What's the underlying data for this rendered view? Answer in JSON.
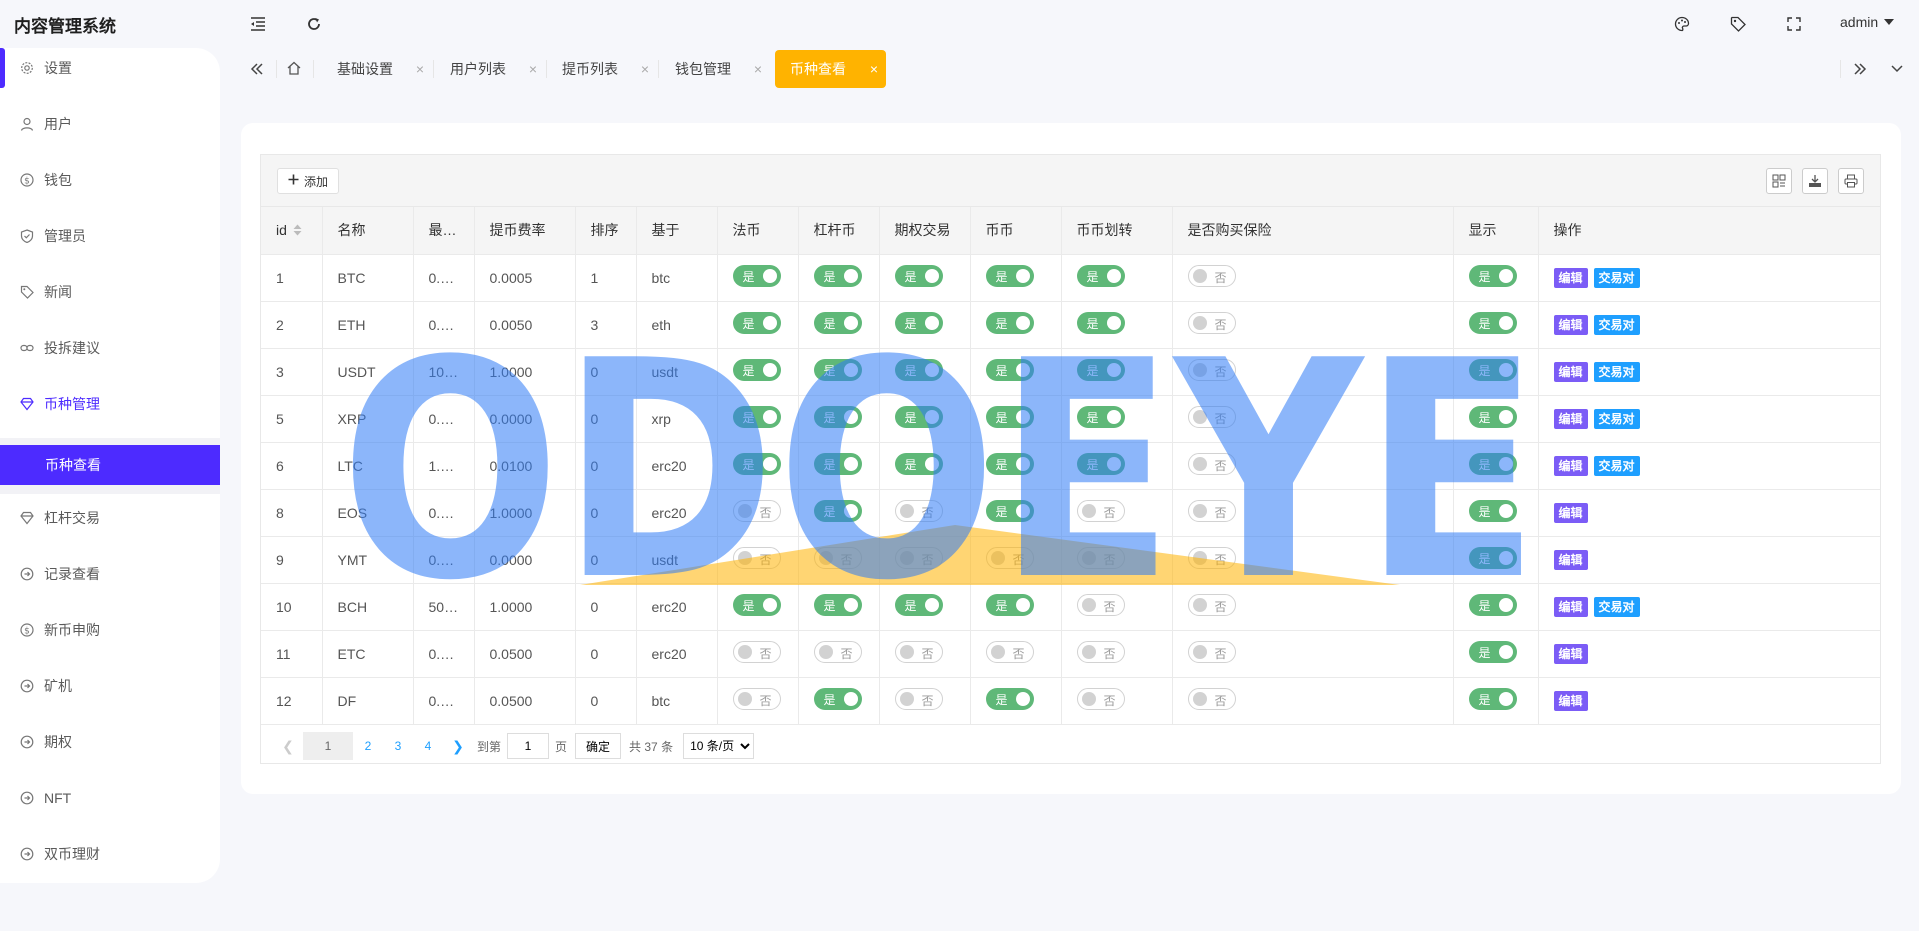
{
  "app": {
    "title": "内容管理系统",
    "user": "admin"
  },
  "sidebar": {
    "items": [
      {
        "label": "设置",
        "icon": "gear-icon"
      },
      {
        "label": "用户",
        "icon": "user-icon"
      },
      {
        "label": "钱包",
        "icon": "coin-icon"
      },
      {
        "label": "管理员",
        "icon": "shield-icon"
      },
      {
        "label": "新闻",
        "icon": "tag-icon"
      },
      {
        "label": "投拆建议",
        "icon": "link-icon"
      },
      {
        "label": "币种管理",
        "icon": "diamond-icon"
      },
      {
        "label": "杠杆交易",
        "icon": "diamond-icon"
      },
      {
        "label": "记录查看",
        "icon": "circle-icon"
      },
      {
        "label": "新币申购",
        "icon": "coin-icon"
      },
      {
        "label": "矿机",
        "icon": "circle-icon"
      },
      {
        "label": "期权",
        "icon": "circle-icon"
      },
      {
        "label": "NFT",
        "icon": "circle-icon"
      },
      {
        "label": "双币理财",
        "icon": "circle-icon"
      }
    ],
    "active_sub": "币种查看"
  },
  "tabs": [
    {
      "label": "基础设置"
    },
    {
      "label": "用户列表"
    },
    {
      "label": "提币列表"
    },
    {
      "label": "钱包管理"
    },
    {
      "label": "币种查看"
    }
  ],
  "toolbar": {
    "add_label": "添加"
  },
  "table": {
    "columns": [
      "id",
      "名称",
      "最…",
      "提币费率",
      "排序",
      "基于",
      "法币",
      "杠杆币",
      "期权交易",
      "币币",
      "币币划转",
      "是否购买保险",
      "显示",
      "操作"
    ],
    "switch_on": "是",
    "switch_off": "否",
    "edit_label": "编辑",
    "pair_label": "交易对",
    "rows": [
      {
        "id": "1",
        "name": "BTC",
        "min": "0.…",
        "fee": "0.0005",
        "sort": "1",
        "base": "btc",
        "fiat": true,
        "lev": true,
        "opt": true,
        "coin": true,
        "transfer": true,
        "ins": false,
        "show": true,
        "pair": true
      },
      {
        "id": "2",
        "name": "ETH",
        "min": "0.…",
        "fee": "0.0050",
        "sort": "3",
        "base": "eth",
        "fiat": true,
        "lev": true,
        "opt": true,
        "coin": true,
        "transfer": true,
        "ins": false,
        "show": true,
        "pair": true
      },
      {
        "id": "3",
        "name": "USDT",
        "min": "10…",
        "fee": "1.0000",
        "sort": "0",
        "base": "usdt",
        "fiat": true,
        "lev": true,
        "opt": true,
        "coin": true,
        "transfer": true,
        "ins": false,
        "show": true,
        "pair": true
      },
      {
        "id": "5",
        "name": "XRP",
        "min": "0.…",
        "fee": "0.0000",
        "sort": "0",
        "base": "xrp",
        "fiat": true,
        "lev": true,
        "opt": true,
        "coin": true,
        "transfer": true,
        "ins": false,
        "show": true,
        "pair": true
      },
      {
        "id": "6",
        "name": "LTC",
        "min": "1.…",
        "fee": "0.0100",
        "sort": "0",
        "base": "erc20",
        "fiat": true,
        "lev": true,
        "opt": true,
        "coin": true,
        "transfer": true,
        "ins": false,
        "show": true,
        "pair": true
      },
      {
        "id": "8",
        "name": "EOS",
        "min": "0.…",
        "fee": "1.0000",
        "sort": "0",
        "base": "erc20",
        "fiat": false,
        "lev": true,
        "opt": false,
        "coin": true,
        "transfer": false,
        "ins": false,
        "show": true,
        "pair": false
      },
      {
        "id": "9",
        "name": "YMT",
        "min": "0.…",
        "fee": "0.0000",
        "sort": "0",
        "base": "usdt",
        "fiat": false,
        "lev": false,
        "opt": false,
        "coin": false,
        "transfer": false,
        "ins": false,
        "show": true,
        "pair": false
      },
      {
        "id": "10",
        "name": "BCH",
        "min": "50…",
        "fee": "1.0000",
        "sort": "0",
        "base": "erc20",
        "fiat": true,
        "lev": true,
        "opt": true,
        "coin": true,
        "transfer": false,
        "ins": false,
        "show": true,
        "pair": true
      },
      {
        "id": "11",
        "name": "ETC",
        "min": "0.…",
        "fee": "0.0500",
        "sort": "0",
        "base": "erc20",
        "fiat": false,
        "lev": false,
        "opt": false,
        "coin": false,
        "transfer": false,
        "ins": false,
        "show": true,
        "pair": false
      },
      {
        "id": "12",
        "name": "DF",
        "min": "0.…",
        "fee": "0.0500",
        "sort": "0",
        "base": "btc",
        "fiat": false,
        "lev": true,
        "opt": false,
        "coin": true,
        "transfer": false,
        "ins": false,
        "show": true,
        "pair": false
      }
    ]
  },
  "pagination": {
    "current": "1",
    "pages": [
      "2",
      "3",
      "4"
    ],
    "goto_label": "到第",
    "goto_value": "1",
    "page_unit": "页",
    "confirm_label": "确定",
    "total_label": "共 37 条",
    "page_size": "10 条/页"
  },
  "watermark": {
    "text": "ODOEYE"
  },
  "colors": {
    "accent": "#4d2bff",
    "tab_active": "#ffb300",
    "switch_on": "#5fb878",
    "edit_btn": "#7b5cf6",
    "pair_btn": "#1e9fff"
  }
}
